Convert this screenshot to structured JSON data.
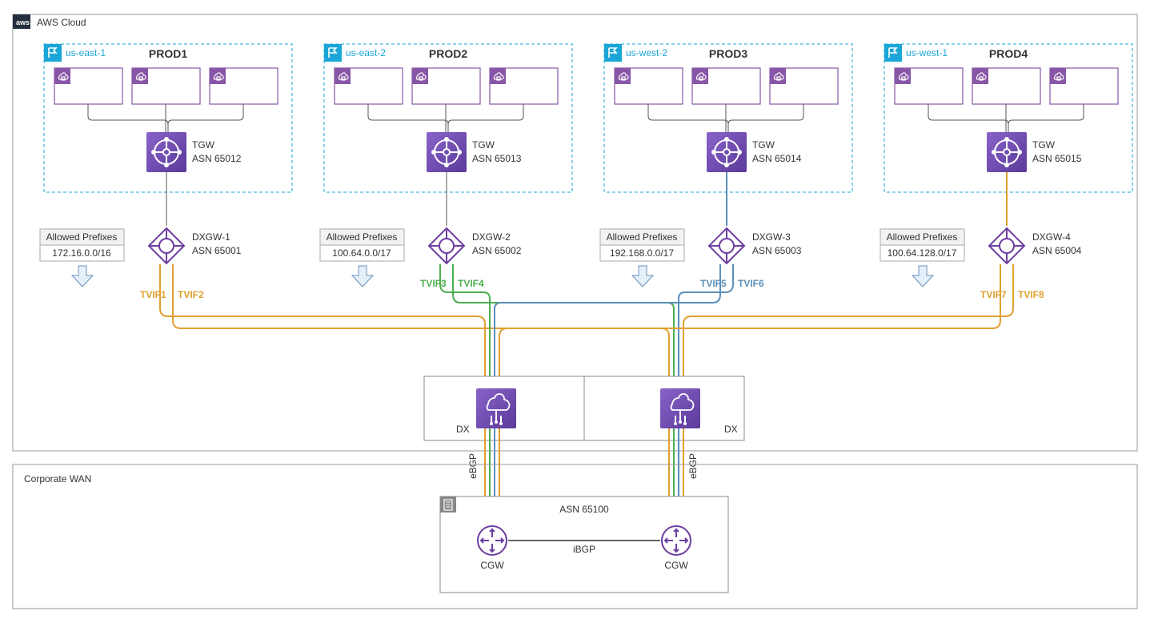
{
  "cloud": {
    "title": "AWS Cloud"
  },
  "wan": {
    "title": "Corporate WAN"
  },
  "regions": [
    {
      "code": "us-east-1",
      "name": "PROD1",
      "tgw_label1": "TGW",
      "tgw_label2": "ASN 65012",
      "dxgw_label1": "DXGW-1",
      "dxgw_label2": "ASN 65001",
      "prefix_title": "Allowed Prefixes",
      "prefix_value": "172.16.0.0/16",
      "tvif_a": "TVIF1",
      "tvif_b": "TVIF2",
      "tvif_color": "#e0a030"
    },
    {
      "code": "us-east-2",
      "name": "PROD2",
      "tgw_label1": "TGW",
      "tgw_label2": "ASN 65013",
      "dxgw_label1": "DXGW-2",
      "dxgw_label2": "ASN 65002",
      "prefix_title": "Allowed Prefixes",
      "prefix_value": "100.64.0.0/17",
      "tvif_a": "TVIF3",
      "tvif_b": "TVIF4",
      "tvif_color": "#4caf50"
    },
    {
      "code": "us-west-2",
      "name": "PROD3",
      "tgw_label1": "TGW",
      "tgw_label2": "ASN 65014",
      "dxgw_label1": "DXGW-3",
      "dxgw_label2": "ASN 65003",
      "prefix_title": "Allowed Prefixes",
      "prefix_value": "192.168.0.0/17",
      "tvif_a": "TVIF5",
      "tvif_b": "TVIF6",
      "tvif_color": "#5b8fb9"
    },
    {
      "code": "us-west-1",
      "name": "PROD4",
      "tgw_label1": "TGW",
      "tgw_label2": "ASN 65015",
      "dxgw_label1": "DXGW-4",
      "dxgw_label2": "ASN 65004",
      "prefix_title": "Allowed Prefixes",
      "prefix_value": "100.64.128.0/17",
      "tvif_a": "TVIF7",
      "tvif_b": "TVIF8",
      "tvif_color": "#e0a030"
    }
  ],
  "dx": {
    "label": "DX"
  },
  "ebgp": "eBGP",
  "ibgp": "iBGP",
  "cgw": {
    "asn": "ASN 65100",
    "label": "CGW"
  }
}
